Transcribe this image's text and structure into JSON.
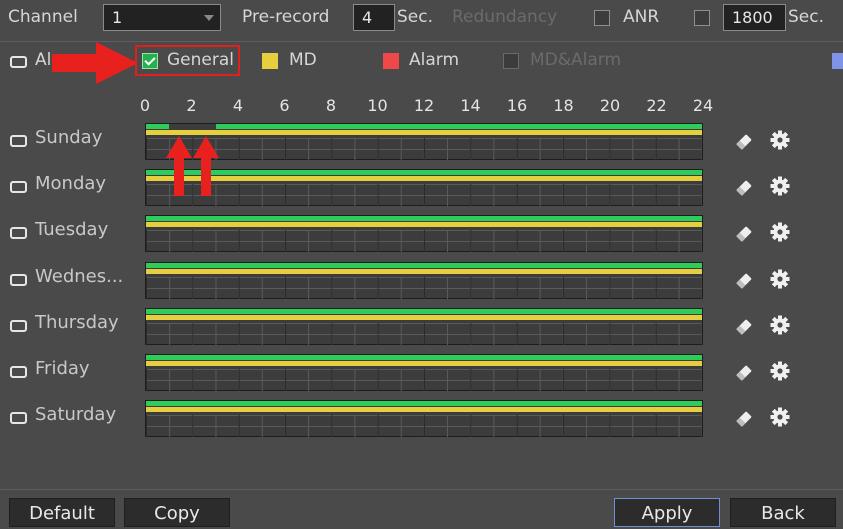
{
  "header": {
    "channel_label": "Channel",
    "channel_value": "1",
    "prerecord_label": "Pre-record",
    "prerecord_value": "4",
    "prerecord_unit": "Sec.",
    "redundancy_label": "Redundancy",
    "anr_label": "ANR",
    "anr_value": "1800",
    "anr_unit": "Sec."
  },
  "legend": {
    "all_label": "Al",
    "general_label": "General",
    "md_label": "MD",
    "alarm_label": "Alarm",
    "mdalarm_label": "MD&Alarm",
    "colors": {
      "general": "#2ecc5a",
      "md": "#e6cf3f",
      "alarm": "#f04848",
      "mdalarm": "#7f93e8"
    }
  },
  "timeline": {
    "hours": [
      "0",
      "2",
      "4",
      "6",
      "8",
      "10",
      "12",
      "14",
      "16",
      "18",
      "20",
      "22",
      "24"
    ],
    "days": [
      {
        "label": "Sunday",
        "general": [
          [
            0,
            1
          ],
          [
            3,
            24
          ]
        ],
        "md": [
          [
            0,
            24
          ]
        ]
      },
      {
        "label": "Monday",
        "general": [
          [
            0,
            24
          ]
        ],
        "md": [
          [
            0,
            24
          ]
        ]
      },
      {
        "label": "Tuesday",
        "general": [
          [
            0,
            24
          ]
        ],
        "md": [
          [
            0,
            24
          ]
        ]
      },
      {
        "label": "Wednes...",
        "general": [
          [
            0,
            24
          ]
        ],
        "md": [
          [
            0,
            24
          ]
        ]
      },
      {
        "label": "Thursday",
        "general": [
          [
            0,
            24
          ]
        ],
        "md": [
          [
            0,
            24
          ]
        ]
      },
      {
        "label": "Friday",
        "general": [
          [
            0,
            24
          ]
        ],
        "md": [
          [
            0,
            24
          ]
        ]
      },
      {
        "label": "Saturday",
        "general": [
          [
            0,
            24
          ]
        ],
        "md": [
          [
            0,
            24
          ]
        ]
      }
    ]
  },
  "footer": {
    "default_label": "Default",
    "copy_label": "Copy",
    "apply_label": "Apply",
    "back_label": "Back"
  },
  "icons": {
    "edit": "eraser-icon",
    "settings": "gear-icon",
    "annotation": "red-arrow-icon"
  }
}
